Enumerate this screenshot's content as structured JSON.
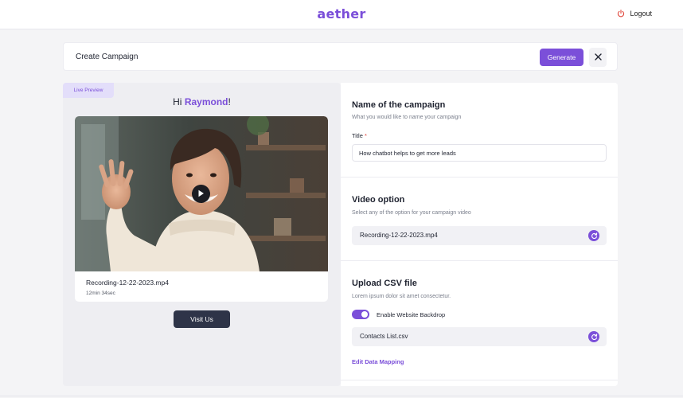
{
  "app": {
    "brand": "aether",
    "logout_label": "Logout"
  },
  "header": {
    "title": "Create Campaign",
    "generate_label": "Generate"
  },
  "preview": {
    "tag": "Live Preview",
    "greeting_prefix": "Hi ",
    "greeting_name": "Raymond",
    "greeting_suffix": "!",
    "video_name": "Recording-12-22-2023.mp4",
    "video_duration": "12min 34sec",
    "visit_label": "Visit Us"
  },
  "form": {
    "campaign": {
      "title": "Name of the campaign",
      "subtitle": "What you would like to name your campaign",
      "field_label": "Title",
      "required_mark": "*",
      "value": "How chatbot helps to get more leads"
    },
    "video": {
      "title": "Video option",
      "subtitle": "Select any of the option for your campaign video",
      "selected": "Recording-12-22-2023.mp4"
    },
    "csv": {
      "title": "Upload CSV file",
      "subtitle": "Lorem ipsum dolor sit amet consectetur.",
      "toggle_label": "Enable Website Backdrop",
      "toggle_on": true,
      "selected": "Contacts List.csv",
      "mapping_link": "Edit Data Mapping"
    }
  },
  "colors": {
    "accent": "#7b4fd9",
    "dark_button": "#2e3448",
    "background": "#f4f4f6"
  }
}
